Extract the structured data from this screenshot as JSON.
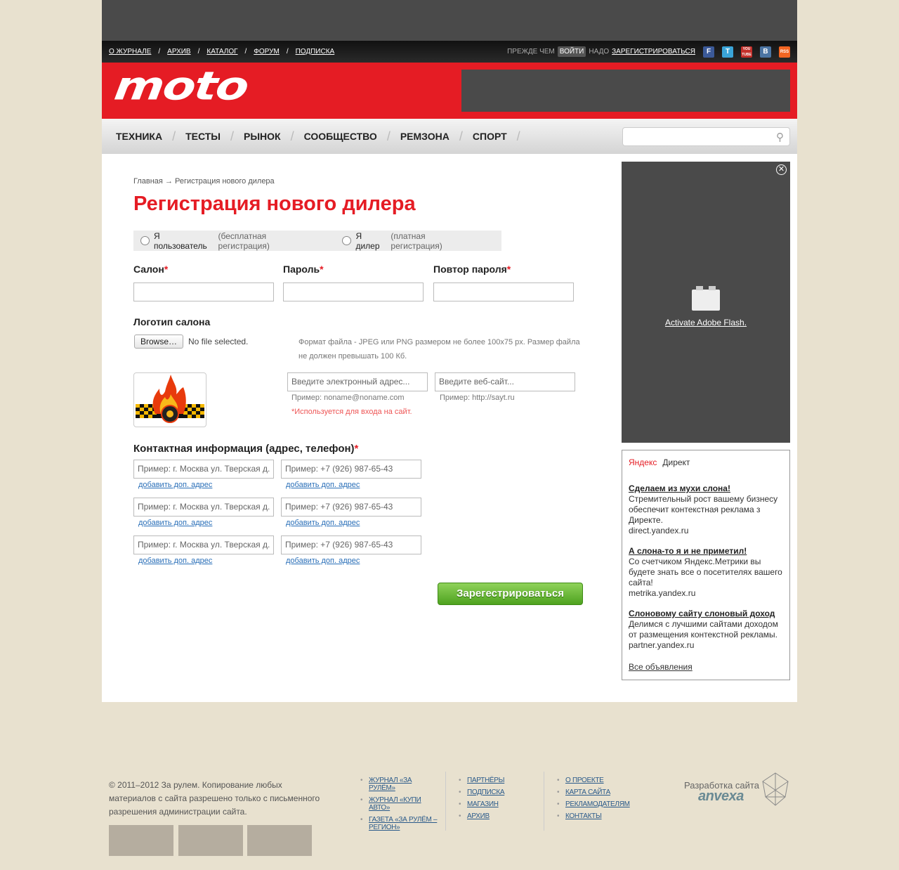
{
  "topnav": {
    "items": [
      "О ЖУРНАЛЕ",
      "АРХИВ",
      "КАТАЛОГ",
      "ФОРУМ",
      "ПОДПИСКА"
    ],
    "before": "ПРЕЖДЕ ЧЕМ",
    "login": "ВОЙТИ",
    "need": "НАДО",
    "register": "ЗАРЕГИСТРИРОВАТЬСЯ"
  },
  "social": [
    "f",
    "t",
    "You Tube",
    "В",
    "rss"
  ],
  "logo": "moto",
  "mainnav": [
    "ТЕХНИКА",
    "ТЕСТЫ",
    "РЫНОК",
    "СООБЩЕСТВО",
    "РЕМЗОНА",
    "СПОРТ"
  ],
  "breadcrumb": {
    "home": "Главная",
    "arrow": "→",
    "current": "Регистрация нового дилера"
  },
  "page_title": "Регистрация нового дилера",
  "radios": {
    "user": "Я пользователь",
    "user_link": "(бесплатная регистрация)",
    "dealer": "Я дилер",
    "dealer_link": "(платная регистрация)"
  },
  "fields": {
    "salon": "Салон",
    "password": "Пароль",
    "password_repeat": "Повтор пароля",
    "required": "*"
  },
  "logo_section": {
    "label": "Логотип салона",
    "browse": "Browse…",
    "nofile": "No file selected.",
    "hint1": "Формат файла - JPEG или PNG размером не более 100x75 px. Размер файла",
    "hint2": "не должен превышать 100 Кб."
  },
  "email": {
    "placeholder": "Введите электронный адрес...",
    "example": "Пример: noname@noname.com",
    "note": "*Используется для входа на сайт."
  },
  "website": {
    "placeholder": "Введите веб-сайт...",
    "example": "Пример: http://sayt.ru"
  },
  "contacts": {
    "label": "Контактная информация (адрес, телефон)",
    "address_placeholder": "Пример: г. Москва ул. Тверская д.",
    "phone_placeholder": "Пример: +7 (926) 987-65-43",
    "add_link": "добавить доп. адрес"
  },
  "submit": "Зарегестрироваться",
  "flash": {
    "close": "✕",
    "activate": "Activate Adobe Flash."
  },
  "yandex": {
    "brand": "Яндекс",
    "direct": "Директ",
    "ads": [
      {
        "title": "Сделаем из мухи слона!",
        "text": "Стремительный рост вашему бизнесу обеспечит контекстная реклама з Директе.",
        "url": "direct.yandex.ru"
      },
      {
        "title": "А слона-то я и не приметил!",
        "text": "Со счетчиком Яндекс.Метрики вы будете знать все о посетителях вашего сайта!",
        "url": "metrika.yandex.ru"
      },
      {
        "title": "Слоновому сайту слоновый доход",
        "text": "Делимся с лучшими сайтами доходом от размещения контекстной рекламы.",
        "url": "partner.yandex.ru"
      }
    ],
    "all": "Все объявления"
  },
  "footer": {
    "copyright": "© 2011–2012 За рулем. Копирование любых материалов с сайта разрешено только с письменного разрешения администрации сайта.",
    "col1": [
      "ЖУРНАЛ «ЗА РУЛЁМ»",
      "ЖУРНАЛ «КУПИ АВТО»",
      "ГАЗЕТА «ЗА РУЛЁМ – РЕГИОН»"
    ],
    "col2": [
      "ПАРТНЁРЫ",
      "ПОДПИСКА",
      "МАГАЗИН",
      "АРХИВ"
    ],
    "col3": [
      "О ПРОЕКТЕ",
      "КАРТА САЙТА",
      "РЕКЛАМОДАТЕЛЯМ",
      "КОНТАКТЫ"
    ],
    "dev": "Разработка сайта",
    "dev_brand": "anvexa"
  }
}
